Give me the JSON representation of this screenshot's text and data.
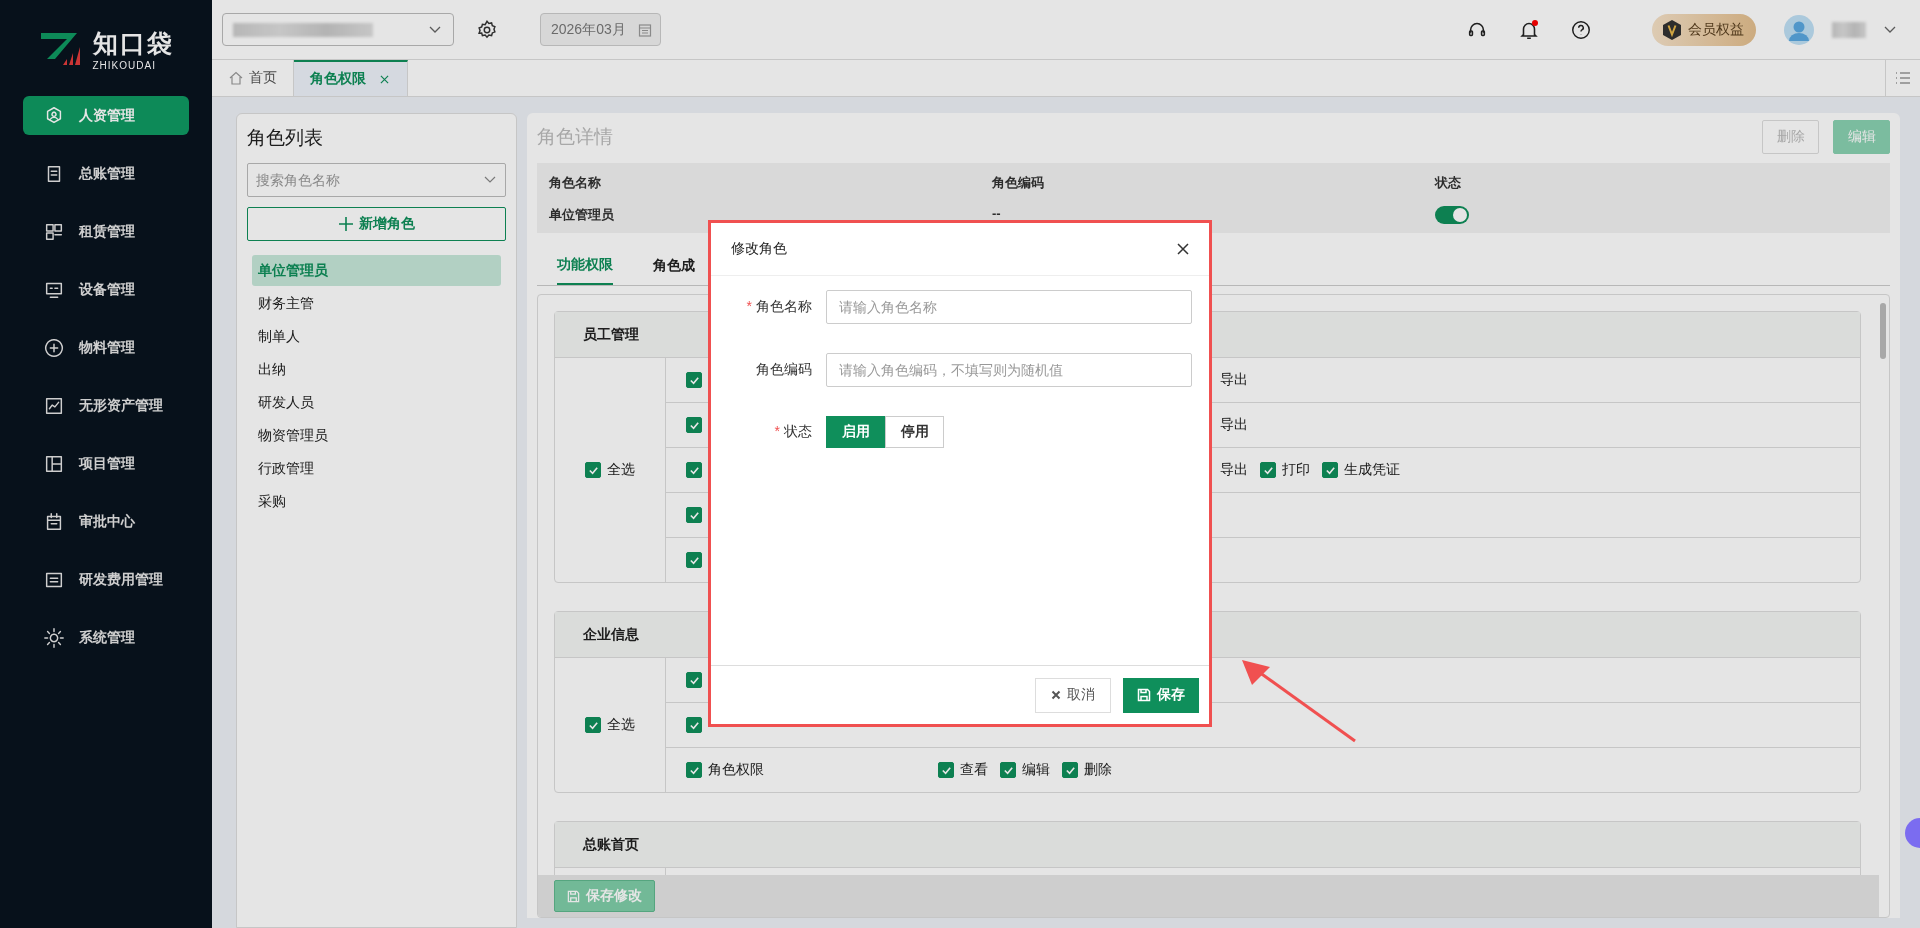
{
  "sidebar": {
    "logo": {
      "name": "知口袋",
      "subtitle": "ZHIKOUDAI"
    },
    "items": [
      {
        "label": "人资管理",
        "selected": true
      },
      {
        "label": "总账管理",
        "selected": false
      },
      {
        "label": "租赁管理",
        "selected": false
      },
      {
        "label": "设备管理",
        "selected": false
      },
      {
        "label": "物料管理",
        "selected": false
      },
      {
        "label": "无形资产管理",
        "selected": false
      },
      {
        "label": "项目管理",
        "selected": false
      },
      {
        "label": "审批中心",
        "selected": false
      },
      {
        "label": "研发费用管理",
        "selected": false
      },
      {
        "label": "系统管理",
        "selected": false
      }
    ]
  },
  "header": {
    "date": "2026年03月",
    "member": "会员权益",
    "notification_dot": true
  },
  "tabs": [
    {
      "label": "首页",
      "selected": false,
      "closable": false
    },
    {
      "label": "角色权限",
      "selected": true,
      "closable": true
    }
  ],
  "role_list": {
    "title": "角色列表",
    "search_placeholder": "搜索角色名称",
    "add_button": "新增角色",
    "roles": [
      {
        "label": "单位管理员",
        "selected": true
      },
      {
        "label": "财务主管",
        "selected": false
      },
      {
        "label": "制单人",
        "selected": false
      },
      {
        "label": "出纳",
        "selected": false
      },
      {
        "label": "研发人员",
        "selected": false
      },
      {
        "label": "物资管理员",
        "selected": false
      },
      {
        "label": "行政管理",
        "selected": false
      },
      {
        "label": "采购",
        "selected": false
      }
    ]
  },
  "detail": {
    "title": "角色详情",
    "buttons": [
      {
        "label": "删除",
        "kind": "secondary"
      },
      {
        "label": "编辑",
        "kind": "primary"
      }
    ],
    "fields": [
      {
        "label": "角色名称",
        "kind": "text",
        "value": "单位管理员"
      },
      {
        "label": "角色编码",
        "kind": "text",
        "value": "--"
      },
      {
        "label": "状态",
        "kind": "toggle",
        "on": true
      }
    ]
  },
  "sub_tabs": [
    {
      "label": "功能权限",
      "selected": true
    },
    {
      "label": "角色成",
      "selected": false
    }
  ],
  "groups": [
    {
      "title": "员工管理",
      "select_all": {
        "label": "全选",
        "checked": true
      },
      "rows": [
        {
          "checked": true,
          "actions": [
            {
              "label": "导出"
            }
          ]
        },
        {
          "checked": true,
          "actions": [
            {
              "label": "导出"
            }
          ]
        },
        {
          "checked": true,
          "actions": [
            {
              "label": "导出"
            },
            {
              "label": "打印",
              "checked": true
            },
            {
              "label": "生成凭证",
              "checked": true
            }
          ]
        },
        {
          "checked": true
        },
        {
          "checked": true
        }
      ]
    },
    {
      "title": "企业信息",
      "select_all": {
        "label": "全选",
        "checked": true
      },
      "rows": [
        {
          "checked": true
        },
        {
          "checked": true
        },
        {
          "label": "角色权限",
          "checked": true,
          "actions": [
            {
              "label": "查看",
              "checked": true
            },
            {
              "label": "编辑",
              "checked": true
            },
            {
              "label": "删除",
              "checked": true
            }
          ]
        }
      ]
    },
    {
      "title": "总账首页"
    }
  ],
  "save_changes": "保存修改",
  "modal": {
    "title": "修改角色",
    "fields": [
      {
        "label": "角色名称",
        "required_mark": "*",
        "kind": "input",
        "placeholder": "请输入角色名称"
      },
      {
        "label": "角色编码",
        "kind": "input",
        "placeholder": "请输入角色编码，不填写则为随机值"
      },
      {
        "label": "状态",
        "required_mark": "*",
        "kind": "segmented",
        "options": [
          {
            "label": "启用",
            "selected": true
          },
          {
            "label": "停用",
            "selected": false
          }
        ]
      }
    ],
    "cancel": "取消",
    "save": "保存"
  }
}
